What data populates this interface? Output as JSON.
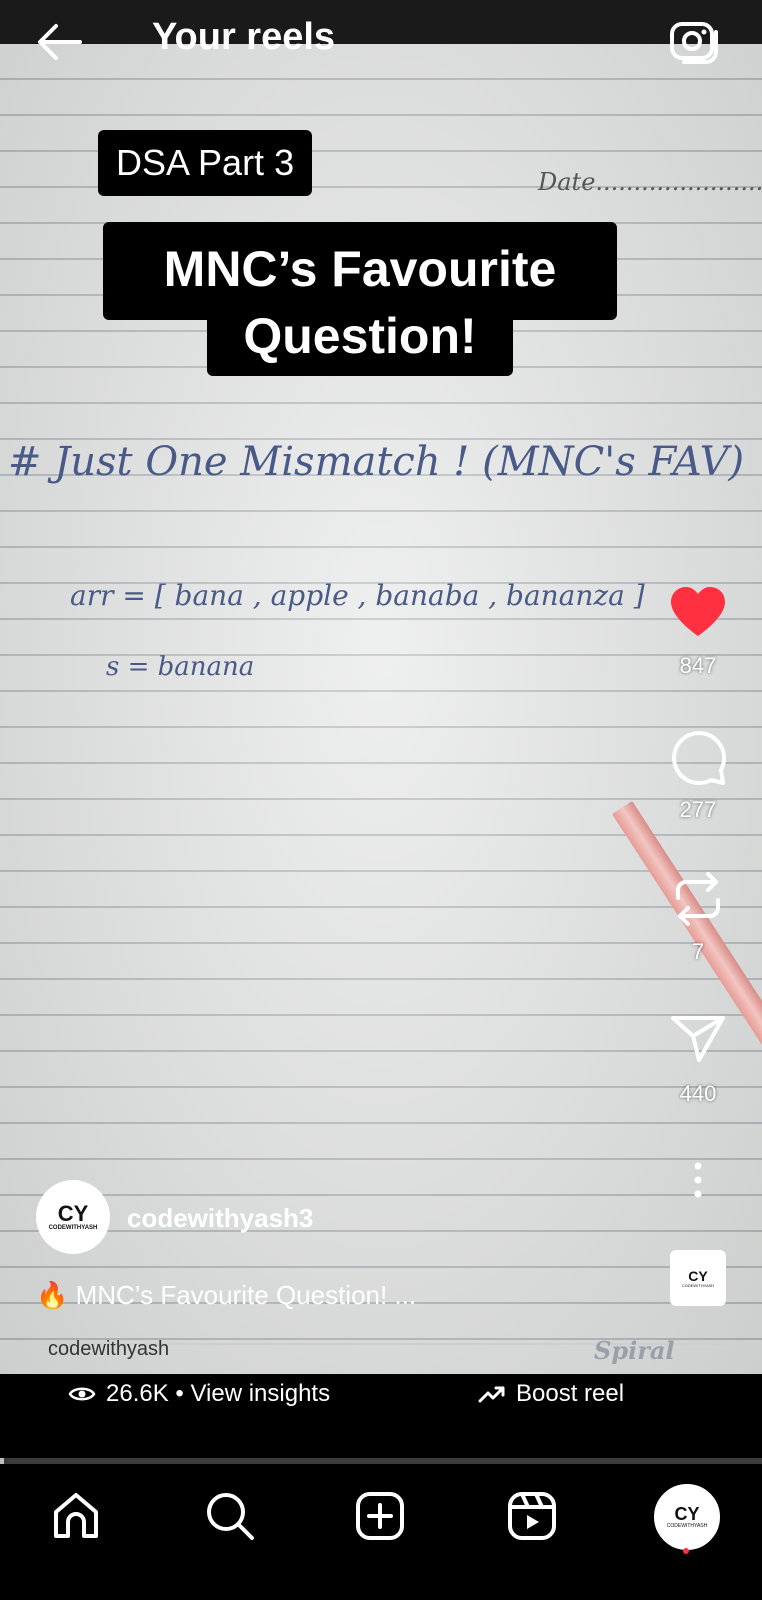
{
  "header": {
    "title": "Your reels",
    "back_icon": "back-arrow-icon",
    "camera_icon": "camera-icon"
  },
  "video": {
    "tag_part": "DSA Part 3",
    "headline_line1": "MNC’s Favourite",
    "headline_line2": "Question!",
    "date_label": "Date......................",
    "notes_heading": "# Just One Mismatch ! (MNC's FAV)",
    "notes_arr": "arr = [ bana , apple , banaba , bananza ]",
    "notes_s": "s = banana",
    "watermark": "codewithyash",
    "paper_brand": "Spiral"
  },
  "actions": {
    "likes": "847",
    "comments": "277",
    "reposts": "7",
    "shares": "440",
    "like_color": "#ff3040"
  },
  "author": {
    "username": "codewithyash3",
    "avatar_logo": "CY",
    "avatar_text": "CODEWITHYASH",
    "caption": "🔥 MNC’s Favourite Question! ..."
  },
  "audio": {
    "logo": "CY",
    "text": "CODEWITHYASH"
  },
  "insights": {
    "views": "26.6K • View insights",
    "boost": "Boost reel"
  },
  "playback": {
    "progress": 0.005
  },
  "nav": {
    "items": [
      "home-icon",
      "search-icon",
      "create-icon",
      "reels-icon",
      "profile-avatar"
    ],
    "profile_logo": "CY",
    "profile_text": "CODEWITHYASH"
  }
}
